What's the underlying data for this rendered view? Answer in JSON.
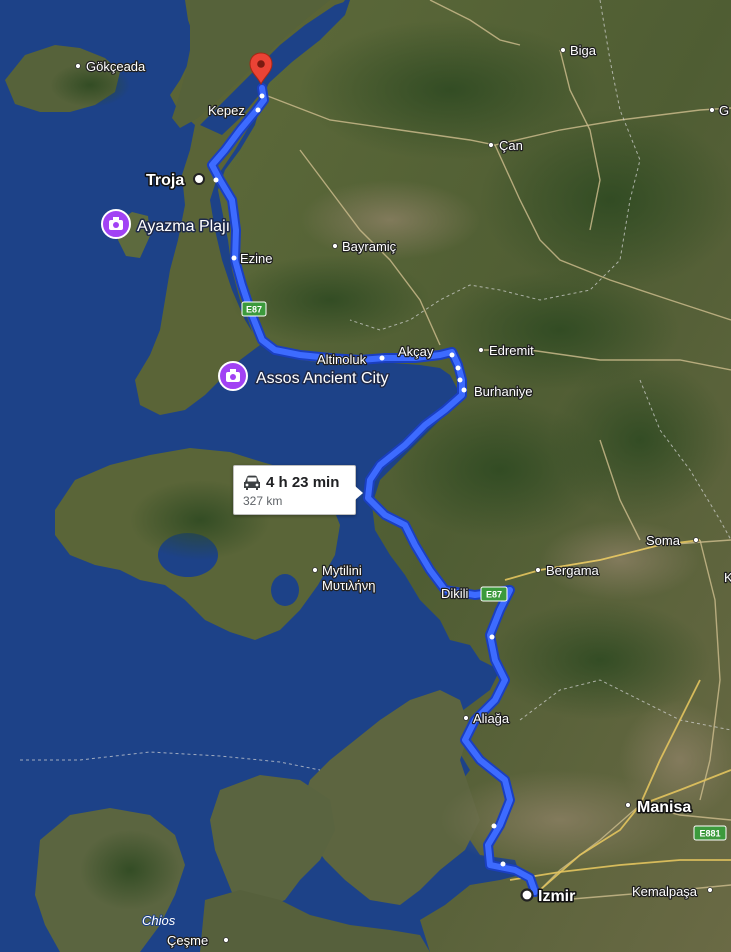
{
  "map": {
    "places": [
      {
        "key": "gokceada",
        "label": "Gökçeada"
      },
      {
        "key": "biga",
        "label": "Biga"
      },
      {
        "key": "kepez",
        "label": "Kepez"
      },
      {
        "key": "can",
        "label": "Çan"
      },
      {
        "key": "troja",
        "label": "Troja"
      },
      {
        "key": "bayramic",
        "label": "Bayramiç"
      },
      {
        "key": "ezine",
        "label": "Ezine"
      },
      {
        "key": "altinoluk",
        "label": "Altinoluk"
      },
      {
        "key": "akcay",
        "label": "Akçay"
      },
      {
        "key": "edremit",
        "label": "Edremit"
      },
      {
        "key": "burhaniye",
        "label": "Burhaniye"
      },
      {
        "key": "mytilini_latin",
        "label": "Mytilini"
      },
      {
        "key": "mytilini_greek",
        "label": "Μυτιλήνη"
      },
      {
        "key": "soma",
        "label": "Soma"
      },
      {
        "key": "bergama",
        "label": "Bergama"
      },
      {
        "key": "dikili",
        "label": "Dikili"
      },
      {
        "key": "aliaga",
        "label": "Aliağa"
      },
      {
        "key": "manisa",
        "label": "Manisa"
      },
      {
        "key": "izmir",
        "label": "Izmir"
      },
      {
        "key": "kemalpasa",
        "label": "Kemalpaşa"
      },
      {
        "key": "chios",
        "label": "Chios"
      },
      {
        "key": "cesme",
        "label": "Çeşme"
      },
      {
        "key": "edge_g",
        "label": "G"
      },
      {
        "key": "edge_k",
        "label": "K"
      }
    ],
    "pois": [
      {
        "key": "ayazma",
        "label": "Ayazma Plajı",
        "icon": "camera-icon",
        "color": "#a142f4"
      },
      {
        "key": "assos",
        "label": "Assos Ancient City",
        "icon": "camera-icon",
        "color": "#a142f4"
      }
    ],
    "road_shields": [
      {
        "key": "e87_north",
        "label": "E87",
        "color": "#3c9a3c"
      },
      {
        "key": "e87_south",
        "label": "E87",
        "color": "#3c9a3c"
      },
      {
        "key": "e881",
        "label": "E881",
        "color": "#3c9a3c"
      }
    ],
    "route": {
      "duration": "4 h 23 min",
      "distance": "327 km",
      "color": "#2a5cff",
      "destination_marker_color": "#ea4335"
    }
  }
}
